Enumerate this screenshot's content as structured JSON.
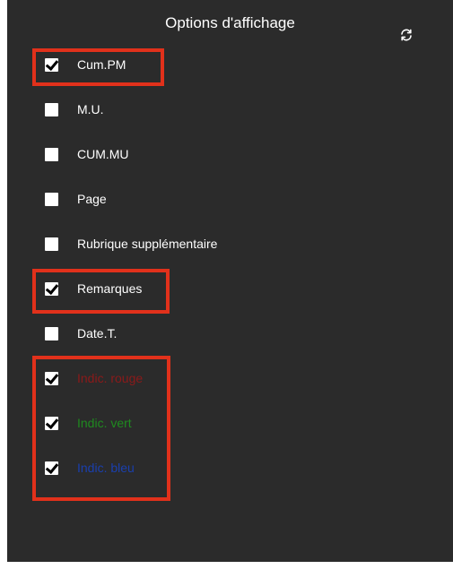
{
  "panel": {
    "title": "Options d'affichage",
    "refresh_icon": "refresh-icon"
  },
  "options": [
    {
      "label": "Cum.PM",
      "checked": true,
      "color": "#ffffff"
    },
    {
      "label": "M.U.",
      "checked": false,
      "color": "#ffffff"
    },
    {
      "label": "CUM.MU",
      "checked": false,
      "color": "#ffffff"
    },
    {
      "label": "Page",
      "checked": false,
      "color": "#ffffff"
    },
    {
      "label": "Rubrique supplémentaire",
      "checked": false,
      "color": "#ffffff"
    },
    {
      "label": "Remarques",
      "checked": true,
      "color": "#ffffff"
    },
    {
      "label": "Date.T.",
      "checked": false,
      "color": "#ffffff"
    },
    {
      "label": "Indic. rouge",
      "checked": true,
      "color": "#8b1a1a"
    },
    {
      "label": "Indic. vert",
      "checked": true,
      "color": "#1f8a1f"
    },
    {
      "label": "Indic. bleu",
      "checked": true,
      "color": "#1a3fae"
    }
  ],
  "highlight_color": "#e1311b"
}
